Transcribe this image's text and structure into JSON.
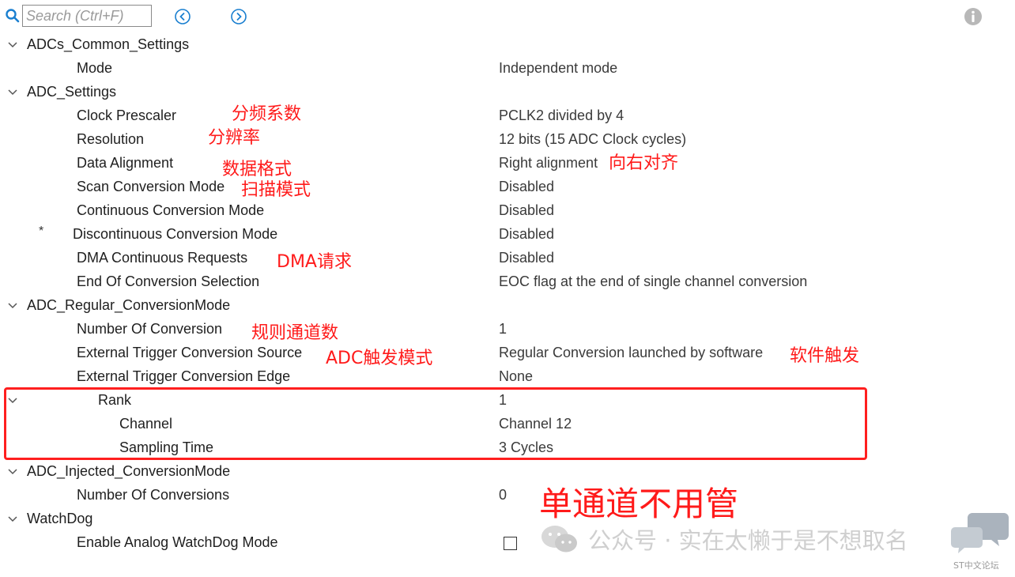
{
  "toolbar": {
    "search_placeholder": "Search (Ctrl+F)",
    "back_icon": "chevron-left-circle-icon",
    "forward_icon": "chevron-right-circle-icon",
    "info_icon": "info-icon"
  },
  "tree": {
    "adc_common": {
      "label": "ADCs_Common_Settings",
      "mode": {
        "label": "Mode",
        "value": "Independent mode"
      }
    },
    "adc_settings": {
      "label": "ADC_Settings",
      "clock_prescaler": {
        "label": "Clock Prescaler",
        "value": "PCLK2 divided by 4"
      },
      "resolution": {
        "label": "Resolution",
        "value": "12 bits (15 ADC Clock cycles)"
      },
      "data_alignment": {
        "label": "Data Alignment",
        "value": "Right alignment"
      },
      "scan_mode": {
        "label": "Scan Conversion Mode",
        "value": "Disabled"
      },
      "continuous_mode": {
        "label": "Continuous Conversion Mode",
        "value": "Disabled"
      },
      "discontinuous_mode": {
        "label": "Discontinuous Conversion Mode",
        "value": "Disabled",
        "marker": "*"
      },
      "dma_requests": {
        "label": "DMA Continuous Requests",
        "value": "Disabled"
      },
      "eoc_selection": {
        "label": "End Of Conversion Selection",
        "value": "EOC flag at the end of single channel conversion"
      }
    },
    "adc_regular": {
      "label": "ADC_Regular_ConversionMode",
      "num_conversion": {
        "label": "Number Of Conversion",
        "value": "1"
      },
      "ext_trigger_source": {
        "label": "External Trigger Conversion Source",
        "value": "Regular Conversion launched by software"
      },
      "ext_trigger_edge": {
        "label": "External Trigger Conversion Edge",
        "value": "None"
      },
      "rank": {
        "label": "Rank",
        "value": "1"
      },
      "channel": {
        "label": "Channel",
        "value": "Channel 12"
      },
      "sampling_time": {
        "label": "Sampling Time",
        "value": "3 Cycles"
      }
    },
    "adc_injected": {
      "label": "ADC_Injected_ConversionMode",
      "num_conversions": {
        "label": "Number Of Conversions",
        "value": "0"
      }
    },
    "watchdog": {
      "label": "WatchDog",
      "enable_mode": {
        "label": "Enable Analog WatchDog Mode",
        "checked": false
      }
    }
  },
  "annotations": {
    "clock_prescaler": "分频系数",
    "resolution": "分辨率",
    "data_format": "数据格式",
    "alignment": "向右对齐",
    "scan_mode": "扫描模式",
    "dma": "DMA请求",
    "rule_channels": "规则通道数",
    "trigger_mode": "ADC触发模式",
    "software_trigger": "软件触发",
    "single_channel": "单通道不用管"
  },
  "watermark": {
    "text": "公众号 · 实在太懒于是不想取名",
    "site": "ST中文论坛"
  },
  "colors": {
    "annotation": "#ff1a1a",
    "highlight_border": "#ff1f1f"
  }
}
